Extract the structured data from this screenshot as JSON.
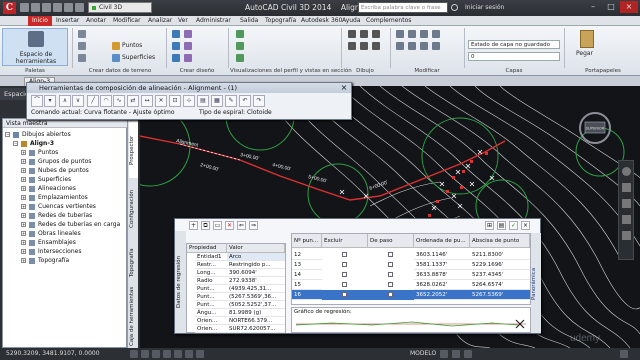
{
  "app": {
    "workspace": "Civil 3D",
    "title": "AutoCAD Civil 3D 2014",
    "document": "Align-3.dwg",
    "search_placeholder": "Escriba palabra clave o frase",
    "login": "Iniciar sesión",
    "logo_letter": "C"
  },
  "ribbon": {
    "tabs": [
      "Inicio",
      "Insertar",
      "Anotar",
      "Modificar",
      "Analizar",
      "Ver",
      "Administrar",
      "Salida",
      "Topografía",
      "Autodesk 360",
      "Ayuda",
      "Complementos"
    ],
    "active_tab": "Inicio",
    "panels": {
      "paletas": {
        "button": "Espacio de herramientas",
        "title": "Paletas"
      },
      "terreno": {
        "items": [
          "Puntos",
          "Superficies"
        ],
        "title": "Crear datos de terreno"
      },
      "diseno": {
        "title": "Crear diseño"
      },
      "perfil": {
        "title": "Visualizaciones del perfil y vistas en sección"
      },
      "dibujo": {
        "title": "Dibujo"
      },
      "modificar": {
        "title": "Modificar"
      },
      "capas": {
        "layer_state": "Estado de capa no guardado",
        "layer_value": "0",
        "title": "Capas"
      },
      "portapapeles": {
        "button": "Pegar",
        "title": "Portapapeles"
      }
    }
  },
  "file_tabs": [
    "Align-3",
    "Alig"
  ],
  "left": {
    "espacio_label": "Espacio",
    "prospector_title": "Vista maestra",
    "tree": [
      {
        "label": "Dibujos abiertos",
        "level": 0
      },
      {
        "label": "Align-3",
        "level": 1
      },
      {
        "label": "Puntos",
        "level": 2
      },
      {
        "label": "Grupos de puntos",
        "level": 2
      },
      {
        "label": "Nubes de puntos",
        "level": 2
      },
      {
        "label": "Superficies",
        "level": 2
      },
      {
        "label": "Alineaciones",
        "level": 2
      },
      {
        "label": "Emplazamientos",
        "level": 2
      },
      {
        "label": "Cuencas vertientes",
        "level": 2
      },
      {
        "label": "Redes de tuberías",
        "level": 2
      },
      {
        "label": "Redes de tuberías en carga",
        "level": 2
      },
      {
        "label": "Obras lineales",
        "level": 2
      },
      {
        "label": "Ensamblajes",
        "level": 2
      },
      {
        "label": "Intersecciones",
        "level": 2
      },
      {
        "label": "Topografía",
        "level": 2
      }
    ],
    "vertical_tabs": [
      "Prospector",
      "Configuración",
      "Topografía",
      "Caja de herramientas"
    ]
  },
  "layout_tools": {
    "title": "Herramientas de composición de alineación - Alignment - (1)",
    "current_command": "Comando actual: Curva flotante - Ajuste óptimo",
    "spiral_type": "Tipo de espiral: Clotoide",
    "close": "×"
  },
  "regression_editor": {
    "left_tab": "Datos de regresión",
    "props_headers": [
      "Propiedad",
      "Valor"
    ],
    "props": [
      {
        "name": "Entidad1",
        "value": "Arco"
      },
      {
        "name": "Restr...",
        "value": "Restringido p..."
      },
      {
        "name": "Long...",
        "value": "390.6094'"
      },
      {
        "name": "Radio",
        "value": "272.9338'"
      },
      {
        "name": "Punt...",
        "value": "(4939.425,31..."
      },
      {
        "name": "Punt...",
        "value": "(5267.5369',36..."
      },
      {
        "name": "Punt...",
        "value": "(5052.5252',37..."
      },
      {
        "name": "Ángu...",
        "value": "81.9989 (g)"
      },
      {
        "name": "Orien...",
        "value": "NORTE66.379..."
      },
      {
        "name": "Orien...",
        "value": "SUR72.620057..."
      }
    ],
    "grid_headers": [
      "Nº pun...",
      "Excluir",
      "De paso",
      "Ordenada de pu...",
      "Abscisa de punto"
    ],
    "rows": [
      {
        "n": "12",
        "ord": "3603.1146'",
        "abs": "5211.8300'"
      },
      {
        "n": "13",
        "ord": "3581.1337'",
        "abs": "5229.1696'"
      },
      {
        "n": "14",
        "ord": "3633.8878'",
        "abs": "5237.4345'"
      },
      {
        "n": "15",
        "ord": "3628.0262'",
        "abs": "5264.6574'"
      },
      {
        "n": "16",
        "ord": "3652.2052'",
        "abs": "5267.5369'"
      }
    ],
    "selected_row": 4,
    "graph_label": "Gráfico de regresión:",
    "panoramica": "Panorámica"
  },
  "canvas": {
    "compass": "SUPERIOR",
    "labels": [
      "Alignment",
      "2+00.00'",
      "5+00.00'",
      "4+00.00'",
      "3+00.00'",
      "6+00.00'"
    ],
    "watermark": "udemy"
  },
  "status_bar": {
    "coords": "5290.3209, 3481.9107, 0.0000",
    "model": "MODELO"
  },
  "colors": {
    "accent": "#cc2929",
    "canvas_bg": "#121418",
    "contour": "#d8d8d8",
    "circles": "#2ea044",
    "alignment": "#e03030"
  }
}
